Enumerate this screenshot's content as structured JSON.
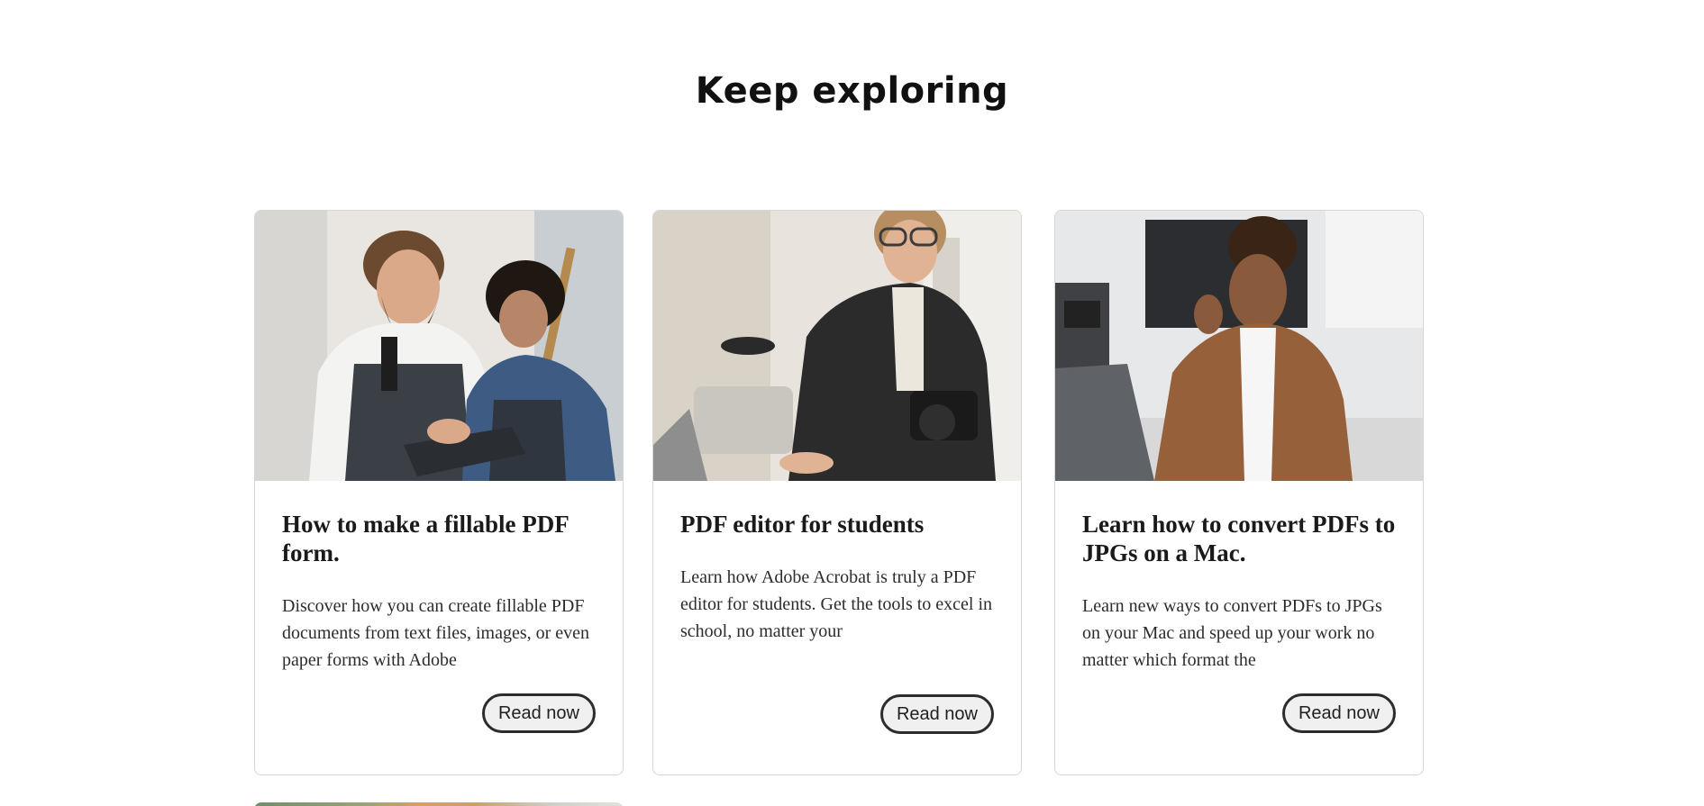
{
  "section": {
    "title": "Keep exploring"
  },
  "cards": [
    {
      "title": "How to make a fillable PDF form.",
      "description": "Discover how you can create fillable PDF documents from text files, images, or even paper forms with Adobe",
      "button_label": "Read now",
      "image_alt": "two people in aprons looking at a tablet"
    },
    {
      "title": "PDF editor for students",
      "description": "Learn how Adobe Acrobat is truly a PDF editor for students. Get the tools to excel in school, no matter your",
      "button_label": "Read now",
      "image_alt": "man with glasses holding a camera at a laptop"
    },
    {
      "title": "Learn how to convert PDFs to JPGs on a Mac.",
      "description": "Learn new ways to convert PDFs to JPGs on your Mac and speed up your work no matter which format the",
      "button_label": "Read now",
      "image_alt": "woman on phone call working on laptop in kitchen"
    }
  ],
  "colors": {
    "button_border": "#2c2c2c",
    "button_bg": "#f0f0f0",
    "card_border": "#d6d6d6"
  }
}
